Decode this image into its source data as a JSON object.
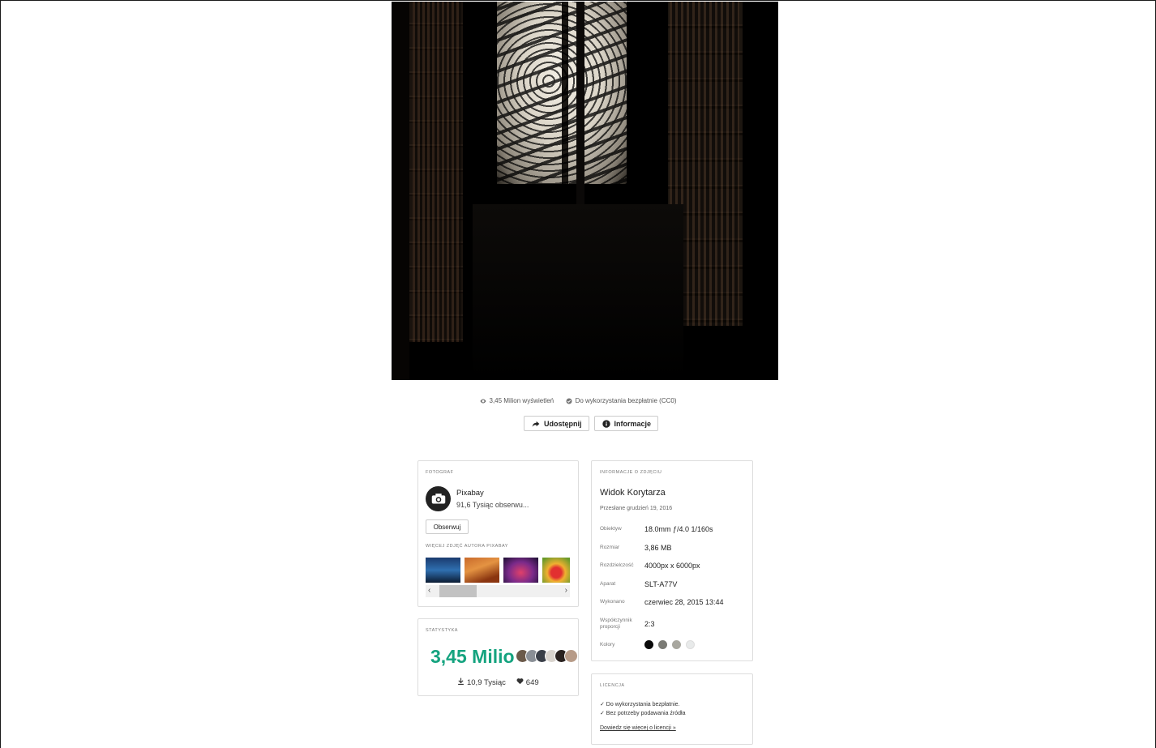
{
  "photo": {
    "alt": ""
  },
  "meta": {
    "views_label": "3,45 Milion wyświetleń",
    "license_label": "Do wykorzystania bezpłatnie (CC0)"
  },
  "actions": {
    "share_label": "Udostępnij",
    "info_label": "Informacje"
  },
  "photographer": {
    "section_title": "Fotograf",
    "name": "Pixabay",
    "followers": "91,6 Tysiąc obserwu...",
    "follow_label": "Obserwuj",
    "more_title": "Więcej zdjęć autora Pixabay",
    "avatar_text": "pixabay"
  },
  "stats": {
    "section_title": "Statystyka",
    "views": "3,45 Milion",
    "downloads": "10,9 Tysiąc",
    "likes": "649"
  },
  "info": {
    "section_title": "Informacje o zdjęciu",
    "title": "Widok Korytarza",
    "uploaded": "Przesłane grudzień 19, 2016",
    "rows": [
      {
        "key": "Obiektyw",
        "value": "18.0mm ƒ/4.0 1/160s"
      },
      {
        "key": "Rozmiar",
        "value": "3,86 MB"
      },
      {
        "key": "Rozdzielczość",
        "value": "4000px x 6000px"
      },
      {
        "key": "Aparat",
        "value": "SLT-A77V"
      },
      {
        "key": "Wykonano",
        "value": "czerwiec 28, 2015 13:44"
      },
      {
        "key": "Współczynnik proporcji",
        "value": "2:3"
      },
      {
        "key": "Kolory",
        "value": ""
      }
    ],
    "colors": [
      "#0a0a0a",
      "#7a7a74",
      "#a8a79f",
      "#e8eaea"
    ]
  },
  "license": {
    "section_title": "Licencja",
    "line1": "✓ Do wykorzystania bezpłatnie.",
    "line2": "✓ Bez potrzeby podawania źródła",
    "link": "Dowiedz się więcej o licencji »"
  },
  "colors": {
    "accent": "#14a37f",
    "border": "#dddddd"
  }
}
